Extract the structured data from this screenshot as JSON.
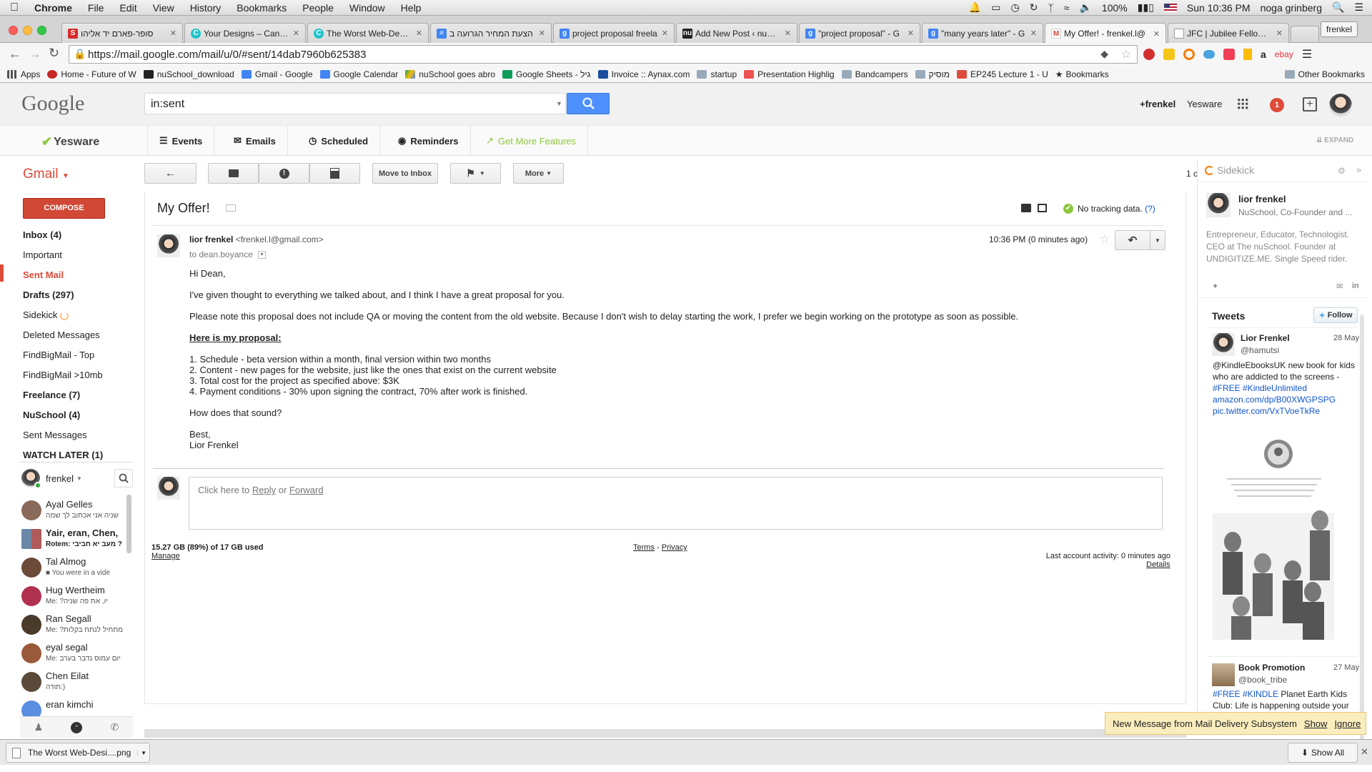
{
  "os_menubar": {
    "app": "Chrome",
    "menus": [
      "File",
      "Edit",
      "View",
      "History",
      "Bookmarks",
      "People",
      "Window",
      "Help"
    ],
    "battery": "100%",
    "clock": "Sun 10:36 PM",
    "user": "noga grinberg"
  },
  "browser": {
    "profile": "frenkel",
    "tabs": [
      {
        "title": "סופר-פארם יד אליהו"
      },
      {
        "title": "Your Designs – Canva"
      },
      {
        "title": "The Worst Web-Design"
      },
      {
        "title": "הצעת המחיר הגרועה ב"
      },
      {
        "title": "project proposal freela"
      },
      {
        "title": "Add New Post ‹ nuSch"
      },
      {
        "title": "\"project proposal\" - G"
      },
      {
        "title": "\"many years later\" - G"
      },
      {
        "title": "My Offer! - frenkel.l@"
      },
      {
        "title": "JFC | Jubilee Fellowsh"
      }
    ],
    "url": "https://mail.google.com/mail/u/0/#sent/14dab7960b625383",
    "bookmarks": [
      "Apps",
      "Home - Future of W",
      "nuSchool_download",
      "Gmail - Google",
      "Google Calendar",
      "nuSchool goes abro",
      "Google Sheets - גיל",
      "Invoice :: Aynax.com",
      "startup",
      "Presentation Highlig",
      "Bandcampers",
      "מוסיק",
      "EP245 Lecture 1 - U",
      "Bookmarks"
    ],
    "other_bookmarks": "Other Bookmarks"
  },
  "gmail": {
    "logo": "Google",
    "search_value": "in:sent",
    "plus_user": "+frenkel",
    "yesware_link": "Yesware",
    "notification_count": "1",
    "yesware_bar": {
      "brand": "Yesware",
      "items": [
        "Events",
        "Emails",
        "Scheduled",
        "Reminders"
      ],
      "more_features": "Get More Features",
      "expand": "EXPAND"
    },
    "product": "Gmail",
    "compose": "COMPOSE",
    "nav": [
      {
        "label": "Inbox (4)",
        "bold": true
      },
      {
        "label": "Important",
        "bold": false
      },
      {
        "label": "Sent Mail",
        "bold": true,
        "active": true
      },
      {
        "label": "Drafts (297)",
        "bold": true
      },
      {
        "label": "Sidekick",
        "bold": false
      },
      {
        "label": "Deleted Messages",
        "bold": false
      },
      {
        "label": "FindBigMail - Top",
        "bold": false
      },
      {
        "label": "FindBigMail >10mb",
        "bold": false
      },
      {
        "label": "Freelance (7)",
        "bold": true
      },
      {
        "label": "NuSchool (4)",
        "bold": true
      },
      {
        "label": "Sent Messages",
        "bold": false
      },
      {
        "label": "WATCH LATER (1)",
        "bold": true
      }
    ],
    "chat_user": "frenkel",
    "chats": [
      {
        "name": "Ayal Gelles",
        "snippet": "שניה אני אכתוב לך שמה",
        "bold": false
      },
      {
        "name": "Yair, eran, Chen,",
        "snippet": "Rotem: מעב יא חביבי ?",
        "bold": true
      },
      {
        "name": "Tal Almog",
        "snippet": "You were in a vide",
        "bold": false
      },
      {
        "name": "Hug Wertheim",
        "snippet": "Me: ?יו, את פה שניה",
        "bold": false
      },
      {
        "name": "Ran Segall",
        "snippet": "Me: ?מתחיל לנתח בקלות",
        "bold": false
      },
      {
        "name": "eyal segal",
        "snippet": "Me: יום עמוס נדבר בערב",
        "bold": false
      },
      {
        "name": "Chen Eilat",
        "snippet": "תודה:)",
        "bold": false
      },
      {
        "name": "eran kimchi",
        "snippet": "",
        "bold": false
      }
    ],
    "toolbar": {
      "move_to_inbox": "Move to Inbox",
      "more": "More",
      "page_partial": "1 c"
    },
    "message": {
      "subject": "My Offer!",
      "tracking": "No tracking data.",
      "tracking_help": "(?)",
      "sender_name": "lior frenkel",
      "sender_email": "<frenkel.l@gmail.com>",
      "to": "to dean.boyance",
      "time": "10:36 PM (0 minutes ago)",
      "greeting": "Hi Dean,",
      "para1": "I've given thought to everything we talked about, and I think I have a great proposal for you.",
      "para2": "Please note this proposal does not include QA or moving the content from the old website. Because I don't wish to delay starting the work, I prefer we begin working on the prototype as soon as possible.",
      "proposal_heading": "Here is my proposal:",
      "items": [
        "1. Schedule - beta version within a month, final version within two months",
        "2. Content - new pages for the website, just like the ones that exist on the current website",
        "3. Total cost for the project as specified above: $3K",
        "4. Payment conditions - 30% upon signing the contract, 70% after work is finished."
      ],
      "question": "How does that sound?",
      "signoff": "Best,",
      "signature": "Lior Frenkel",
      "reply_prompt_pre": "Click here to ",
      "reply_link": "Reply",
      "reply_or": " or ",
      "forward_link": "Forward"
    },
    "footer": {
      "storage": "15.27 GB (89%) of 17 GB used",
      "manage": "Manage",
      "terms": "Terms",
      "sep": " - ",
      "privacy": "Privacy",
      "activity": "Last account activity: 0 minutes ago",
      "details": "Details"
    }
  },
  "sidekick": {
    "title": "Sidekick",
    "profile_name": "lior frenkel",
    "profile_sub": "NuSchool, Co-Founder and ...",
    "bio": "Entrepreneur, Educator, Technologist. CEO at The nuSchool. Founder at UNDIGITIZE.ME. Single Speed rider.",
    "tweets_title": "Tweets",
    "follow": "Follow",
    "tweet1": {
      "name": "Lior Frenkel",
      "handle": "@hamutsi",
      "date": "28 May",
      "text": "@KindleEbooksUK new book for kids who are addicted to the screens - ",
      "tags": "#FREE #KindleUnlimited",
      "link1": "amazon.com/dp/B00XWGPSPG",
      "link2": "pic.twitter.com/VxTVoeTkRe"
    },
    "tweet2": {
      "name": "Book Promotion",
      "handle": "@book_tribe",
      "date": "27 May",
      "tags": "#FREE #KINDLE",
      "text": " Planet Earth Kids Club: Life is happening outside your"
    }
  },
  "notification": {
    "text": "New Message from Mail Delivery Subsystem",
    "show": "Show",
    "ignore": "Ignore"
  },
  "downloads": {
    "file": "The Worst Web-Desi....png",
    "show_all": "Show All"
  },
  "colors": {
    "gmail_red": "#dd4b39",
    "google_blue": "#4d90fe",
    "yesware_green": "#8dc63f",
    "link_blue": "#1155cc"
  }
}
